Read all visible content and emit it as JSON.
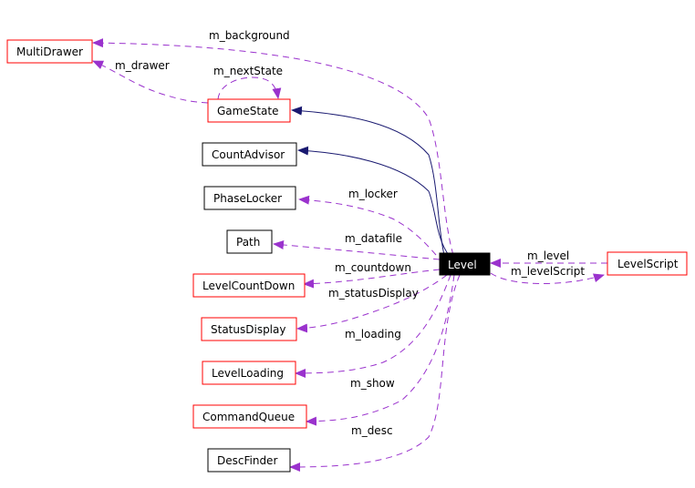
{
  "colors": {
    "usage_edge": "#9a32cd",
    "inheritance_edge": "#191970",
    "node_border_documented": "#ff0000",
    "node_border_plain": "#000000",
    "focus_fill": "#000000",
    "focus_text": "#ffffff"
  },
  "nodes": {
    "multidrawer": "MultiDrawer",
    "gamestate": "GameState",
    "countadvisor": "CountAdvisor",
    "phaselocker": "PhaseLocker",
    "path": "Path",
    "levelcountdown": "LevelCountDown",
    "statusdisplay": "StatusDisplay",
    "levelloading": "LevelLoading",
    "commandqueue": "CommandQueue",
    "descfinder": "DescFinder",
    "level": "Level",
    "levelscript": "LevelScript"
  },
  "edges": {
    "m_background": "m_background",
    "m_drawer": "m_drawer",
    "m_nextState": "m_nextState",
    "m_locker": "m_locker",
    "m_datafile": "m_datafile",
    "m_countdown": "m_countdown",
    "m_statusDisplay": "m_statusDisplay",
    "m_loading": "m_loading",
    "m_show": "m_show",
    "m_desc": "m_desc",
    "m_level": "m_level",
    "m_levelScript": "m_levelScript"
  }
}
